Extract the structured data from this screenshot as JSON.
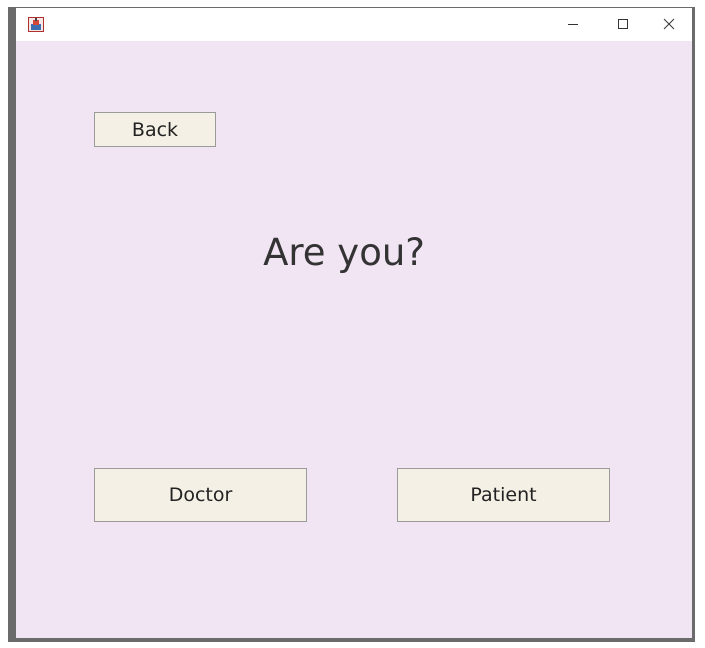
{
  "window": {
    "title": "",
    "controls": {
      "minimize_icon": "minimize-icon",
      "maximize_icon": "maximize-icon",
      "close_icon": "close-icon"
    }
  },
  "main": {
    "back_label": "Back",
    "heading": "Are you?",
    "doctor_label": "Doctor",
    "patient_label": "Patient"
  },
  "colors": {
    "background": "#f1e4f3",
    "button_fill": "#f4f0e5",
    "button_border": "#9a9a9a",
    "text": "#333333"
  }
}
